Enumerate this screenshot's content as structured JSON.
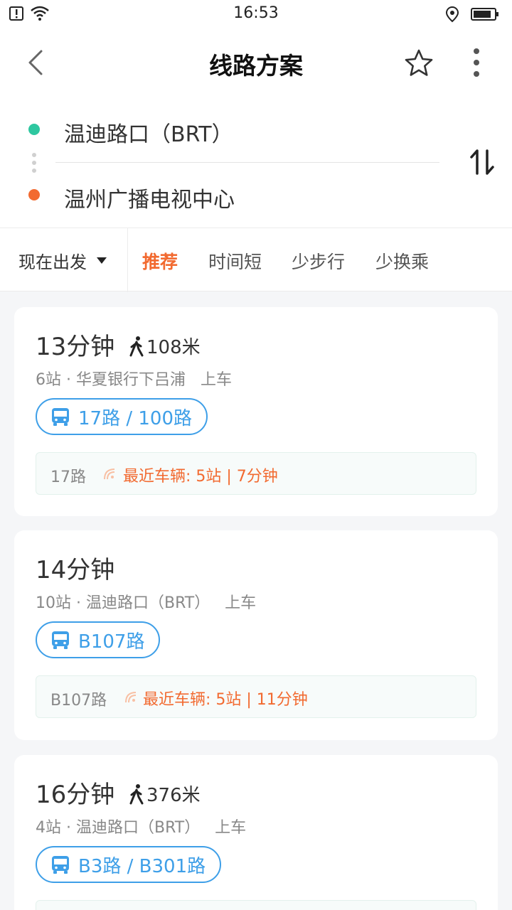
{
  "status_bar": {
    "time": "16:53",
    "icons": [
      "alert-icon",
      "wifi-icon",
      "location-icon",
      "battery-icon"
    ]
  },
  "nav": {
    "title": "线路方案",
    "icons": [
      "back-icon",
      "star-icon",
      "more-icon"
    ]
  },
  "route": {
    "start": "温迪路口（BRT）",
    "end": "温州广播电视中心",
    "colors": {
      "start": "#2ec7a0",
      "end": "#f26a30"
    }
  },
  "filters": {
    "depart_label": "现在出发",
    "tabs": [
      {
        "label": "推荐",
        "active": true
      },
      {
        "label": "时间短",
        "active": false
      },
      {
        "label": "少步行",
        "active": false
      },
      {
        "label": "少换乘",
        "active": false
      }
    ]
  },
  "routes": [
    {
      "duration": "13分钟",
      "walk": "108米",
      "subtitle": "6站 · 华夏银行下吕浦   上车",
      "lines": "17路 / 100路",
      "realtime": {
        "line": "17路",
        "info": "最近车辆: 5站 | 7分钟"
      }
    },
    {
      "duration": "14分钟",
      "walk": "",
      "subtitle": "10站 · 温迪路口（BRT）   上车",
      "lines": "B107路",
      "realtime": {
        "line": "B107路",
        "info": "最近车辆: 5站 | 11分钟"
      }
    },
    {
      "duration": "16分钟",
      "walk": "376米",
      "subtitle": "4站 · 温迪路口（BRT）   上车",
      "lines": "B3路 / B301路",
      "realtime": {
        "line": "",
        "info": ""
      }
    }
  ],
  "theme": {
    "accent": "#f26a30",
    "bus_blue": "#3e9fe8"
  }
}
